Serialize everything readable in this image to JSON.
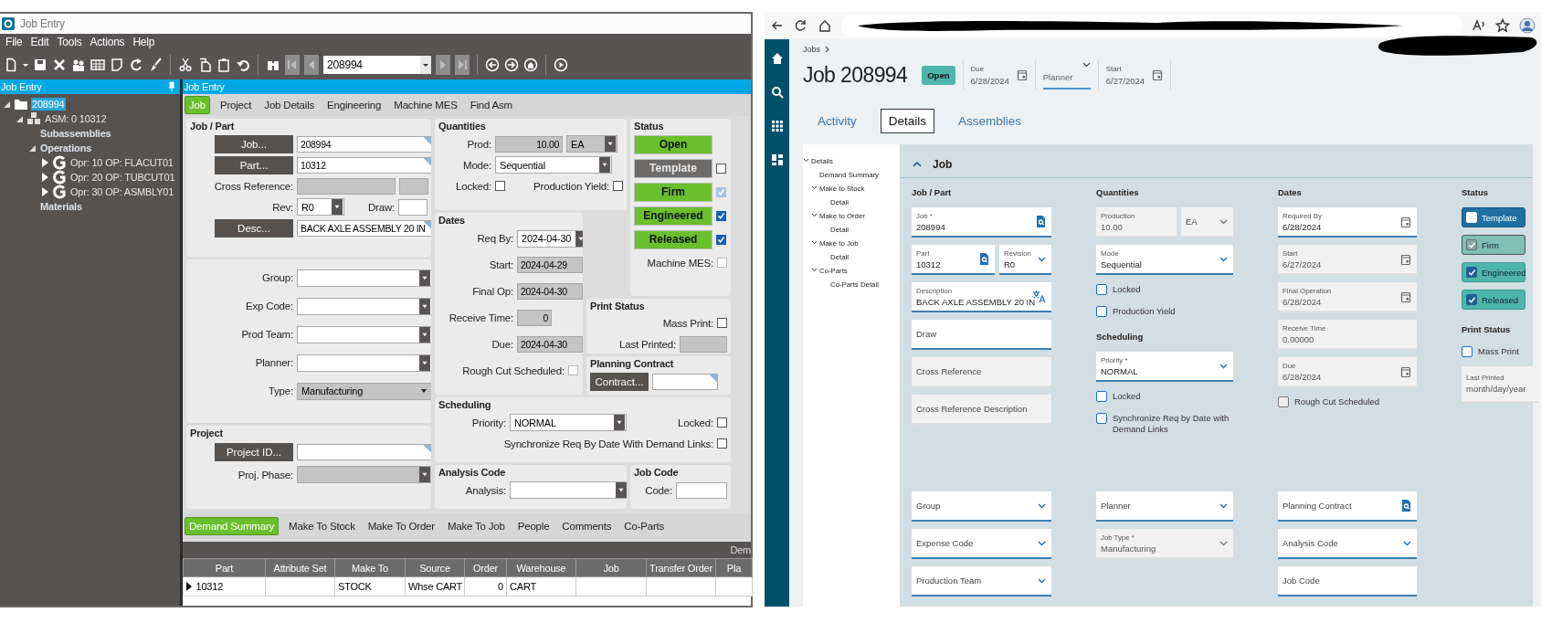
{
  "legacy_window": {
    "title": "Job Entry",
    "menu": [
      "File",
      "Edit",
      "Tools",
      "Actions",
      "Help"
    ],
    "toolbar": {
      "record": "208994"
    },
    "tree_panel": {
      "title": "Job Entry",
      "tree": [
        {
          "label": "208994",
          "kind": "folder",
          "expanded": true,
          "selected": true,
          "children": [
            {
              "label": "ASM: 0 10312",
              "kind": "assembly",
              "expanded": true,
              "selected": false,
              "children": [
                {
                  "label": "Subassemblies",
                  "kind": "group",
                  "selected": false
                },
                {
                  "label": "Operations",
                  "kind": "group",
                  "expanded": true,
                  "selected": false,
                  "children": [
                    {
                      "label": "Opr: 10 OP: FLACUT01",
                      "kind": "operation",
                      "expanded": false,
                      "selected": false
                    },
                    {
                      "label": "Opr: 20 OP: TUBCUT01",
                      "kind": "operation",
                      "expanded": false,
                      "selected": false
                    },
                    {
                      "label": "Opr: 30 OP: ASMBLY01",
                      "kind": "operation",
                      "expanded": false,
                      "selected": false
                    }
                  ]
                },
                {
                  "label": "Materials",
                  "kind": "group",
                  "selected": false
                }
              ]
            }
          ]
        }
      ]
    },
    "form": {
      "title": "Job Entry",
      "tabs": [
        {
          "label": "Job",
          "selected": true
        },
        {
          "label": "Project",
          "selected": false
        },
        {
          "label": "Job Details",
          "selected": false
        },
        {
          "label": "Engineering",
          "selected": false
        },
        {
          "label": "Machine MES",
          "selected": false
        },
        {
          "label": "Find Asm",
          "selected": false
        }
      ],
      "job_part": {
        "title": "Job / Part",
        "job_button": "Job...",
        "job": "208994",
        "part_button": "Part...",
        "part": "10312",
        "cross_reference_label": "Cross Reference:",
        "rev_label": "Rev:",
        "rev": "R0",
        "draw_label": "Draw:",
        "desc_button": "Desc...",
        "description": "BACK AXLE ASSEMBLY 20 IN"
      },
      "attributes": [
        {
          "label": "Group:",
          "kind": "combo"
        },
        {
          "label": "Exp Code:",
          "kind": "combo"
        },
        {
          "label": "Prod Team:",
          "kind": "combo"
        },
        {
          "label": "Planner:",
          "kind": "combo"
        },
        {
          "label": "Type:",
          "kind": "dropdown",
          "value": "Manufacturing"
        }
      ],
      "project": {
        "title": "Project",
        "id_button": "Project ID...",
        "phase_label": "Proj. Phase:"
      },
      "quantities": {
        "title": "Quantities",
        "prod_label": "Prod:",
        "prod": "10.00",
        "uom": "EA",
        "mode_label": "Mode:",
        "mode": "Sequential",
        "locked_label": "Locked:",
        "locked": false,
        "yield_label": "Production Yield:",
        "production_yield": false
      },
      "dates": {
        "title": "Dates",
        "fields": [
          {
            "label": "Req By:",
            "value": "2024-04-30",
            "kind": "combo"
          },
          {
            "label": "Start:",
            "value": "2024-04-29",
            "kind": "readonly"
          },
          {
            "label": "Final Op:",
            "value": "2024-04-30",
            "kind": "readonly"
          },
          {
            "label": "Receive Time:",
            "value": "0",
            "kind": "number"
          },
          {
            "label": "Due:",
            "value": "2024-04-30",
            "kind": "readonly"
          }
        ],
        "rough_cut_label": "Rough Cut Scheduled:",
        "rough_cut": false
      },
      "status": {
        "title": "Status",
        "buttons": [
          {
            "label": "Open",
            "kind": "button",
            "on": true
          },
          {
            "label": "Template",
            "kind": "toggle",
            "on": false,
            "checked": false,
            "disabled": false
          },
          {
            "label": "Firm",
            "kind": "toggle",
            "on": true,
            "checked": true,
            "disabled": true
          },
          {
            "label": "Engineered",
            "kind": "toggle",
            "on": true,
            "checked": true,
            "disabled": false
          },
          {
            "label": "Released",
            "kind": "toggle",
            "on": true,
            "checked": true,
            "disabled": false
          }
        ],
        "machine_mes_label": "Machine MES:",
        "machine_mes": false
      },
      "print_status": {
        "title": "Print Status",
        "mass_print_label": "Mass Print:",
        "mass_print": false,
        "last_printed_label": "Last Printed:"
      },
      "planning_contract": {
        "title": "Planning Contract",
        "button": "Contract..."
      },
      "scheduling": {
        "title": "Scheduling",
        "priority_label": "Priority:",
        "priority": "NORMAL",
        "locked_label": "Locked:",
        "locked": false,
        "sync_label": "Synchronize Req By Date With Demand Links:",
        "sync": false
      },
      "analysis_code": {
        "title": "Analysis Code",
        "label": "Analysis:"
      },
      "job_code": {
        "title": "Job Code",
        "label": "Code:"
      },
      "bottom_tabs": [
        {
          "label": "Demand Summary",
          "selected": true
        },
        {
          "label": "Make To Stock",
          "selected": false
        },
        {
          "label": "Make To Order",
          "selected": false
        },
        {
          "label": "Make To Job",
          "selected": false
        },
        {
          "label": "People",
          "selected": false
        },
        {
          "label": "Comments",
          "selected": false
        },
        {
          "label": "Co-Parts",
          "selected": false
        }
      ],
      "grid": {
        "band_text": "Dem",
        "columns": [
          {
            "label": "Part",
            "kind": "text"
          },
          {
            "label": "Attribute Set",
            "kind": "text"
          },
          {
            "label": "Make To",
            "kind": "text"
          },
          {
            "label": "Source",
            "kind": "text"
          },
          {
            "label": "Order",
            "kind": "number"
          },
          {
            "label": "Warehouse",
            "kind": "text"
          },
          {
            "label": "Job",
            "kind": "text"
          },
          {
            "label": "Transfer Order",
            "kind": "text"
          },
          {
            "label": "Pla",
            "kind": "text"
          }
        ],
        "rows": [
          {
            "cells": [
              "10312",
              null,
              "STOCK",
              "Whse CART",
              "0",
              "CART",
              null,
              null,
              null
            ]
          }
        ]
      }
    }
  },
  "web_app": {
    "breadcrumb": "Jobs",
    "title": "Job 208994",
    "status_badge": "Open",
    "header_fields": [
      {
        "kind": "date",
        "label": "Due",
        "value": "6/28/2024"
      },
      {
        "kind": "dropdown",
        "placeholder": "Planner"
      },
      {
        "kind": "date",
        "label": "Start",
        "value": "6/27/2024"
      }
    ],
    "tabs": [
      {
        "label": "Activity",
        "selected": false
      },
      {
        "label": "Details",
        "selected": true
      },
      {
        "label": "Assemblies",
        "selected": false
      }
    ],
    "section_nav": [
      {
        "label": "Details",
        "expanded": true,
        "children": [
          {
            "label": "Demand Summary"
          },
          {
            "label": "Make to Stock",
            "expanded": true,
            "children": [
              {
                "label": "Detail"
              }
            ]
          },
          {
            "label": "Make to Order",
            "expanded": true,
            "children": [
              {
                "label": "Detail"
              }
            ]
          },
          {
            "label": "Make to Job",
            "expanded": true,
            "children": [
              {
                "label": "Detail"
              }
            ]
          },
          {
            "label": "Co-Parts",
            "expanded": true,
            "children": [
              {
                "label": "Co-Parts Detail"
              }
            ]
          }
        ]
      }
    ],
    "section": {
      "title": "Job",
      "expanded": true,
      "job_part": {
        "title": "Job / Part",
        "fields": [
          {
            "label": "Job *",
            "value": "208994",
            "kind": "lookup",
            "readonly": false
          },
          [
            {
              "label": "Part",
              "value": "10312",
              "kind": "lookup",
              "readonly": false
            },
            {
              "label": "Revision",
              "value": "R0",
              "kind": "dropdown",
              "readonly": false
            }
          ],
          {
            "label": "Description",
            "value": "BACK AXLE ASSEMBLY 20 IN",
            "kind": "translate",
            "readonly": false
          },
          {
            "label": "Draw",
            "kind": "text",
            "readonly": false
          },
          {
            "label": "Cross Reference",
            "kind": "text",
            "readonly": true
          },
          {
            "label": "Cross Reference Description",
            "kind": "text",
            "readonly": true
          }
        ]
      },
      "quantities": {
        "title": "Quantities",
        "fields": [
          [
            {
              "label": "Production",
              "value": "10.00",
              "kind": "text",
              "readonly": true
            },
            {
              "label": "EA",
              "kind": "dropdown",
              "readonly": true
            }
          ],
          {
            "label": "Mode",
            "value": "Sequential",
            "kind": "dropdown",
            "readonly": false
          }
        ],
        "checkboxes": [
          {
            "label": "Locked",
            "checked": false
          },
          {
            "label": "Production Yield",
            "checked": false
          }
        ]
      },
      "scheduling": {
        "title": "Scheduling",
        "fields": [
          {
            "label": "Priority *",
            "value": "NORMAL",
            "kind": "dropdown",
            "readonly": false
          }
        ],
        "checkboxes": [
          {
            "label": "Locked",
            "checked": false
          },
          {
            "label": "Synchronize Req by Date with Demand Links",
            "checked": false
          }
        ]
      },
      "dates": {
        "title": "Dates",
        "fields": [
          {
            "label": "Required By",
            "value": "6/28/2024",
            "kind": "date",
            "readonly": false
          },
          {
            "label": "Start",
            "value": "6/27/2024",
            "kind": "date",
            "readonly": true
          },
          {
            "label": "Final Operation",
            "value": "6/28/2024",
            "kind": "date",
            "readonly": true
          },
          {
            "label": "Receive Time",
            "value": "0.00000",
            "kind": "text",
            "readonly": true
          },
          {
            "label": "Due",
            "value": "6/28/2024",
            "kind": "date",
            "readonly": true
          }
        ],
        "checkboxes": [
          {
            "label": "Rough Cut Scheduled",
            "checked": false,
            "disabled": true
          }
        ]
      },
      "status": {
        "title": "Status",
        "toggles": [
          {
            "label": "Template",
            "checked": false,
            "focused": true,
            "disabled": false
          },
          {
            "label": "Firm",
            "checked": true,
            "focused": false,
            "disabled": true
          },
          {
            "label": "Engineered",
            "checked": true,
            "focused": false,
            "disabled": false
          },
          {
            "label": "Released",
            "checked": true,
            "focused": false,
            "disabled": false
          }
        ]
      },
      "print_status": {
        "title": "Print Status",
        "mass_print_label": "Mass Print",
        "mass_print": false,
        "last_printed": {
          "label": "Last Printed",
          "placeholder": "month/day/year"
        }
      },
      "more_fields": [
        [
          {
            "label": "Group",
            "kind": "dropdown",
            "readonly": false
          },
          {
            "label": "Expense Code",
            "kind": "dropdown",
            "readonly": false
          },
          {
            "label": "Production Team",
            "kind": "dropdown",
            "readonly": false
          }
        ],
        [
          {
            "label": "Planner",
            "kind": "dropdown",
            "readonly": false
          },
          {
            "label": "Job Type *",
            "value": "Manufacturing",
            "kind": "dropdown",
            "readonly": true
          }
        ],
        [
          {
            "label": "Planning Contract",
            "kind": "lookup",
            "readonly": false
          },
          {
            "label": "Analysis Code",
            "kind": "dropdown",
            "readonly": false
          },
          {
            "label": "Job Code",
            "kind": "text",
            "readonly": false
          }
        ]
      ]
    }
  }
}
